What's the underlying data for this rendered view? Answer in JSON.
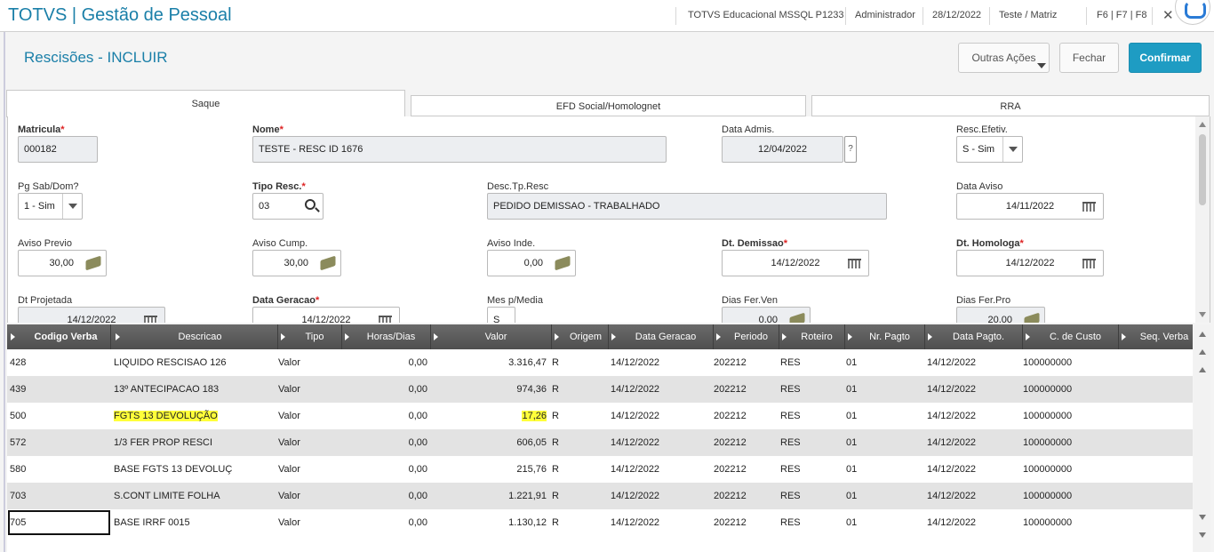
{
  "topbar": {
    "app_title": "TOTVS | Gestão de Pessoal",
    "environment": "TOTVS Educacional MSSQL P1233",
    "user": "Administrador",
    "date": "28/12/2022",
    "branch": "Teste / Matriz",
    "shortcuts": "F6 | F7 | F8",
    "close": "✕"
  },
  "header": {
    "title": "Rescisões - INCLUIR",
    "other_actions": "Outras Ações",
    "close_label": "Fechar",
    "confirm_label": "Confirmar"
  },
  "tabs": [
    {
      "label": "Saque",
      "active": true
    },
    {
      "label": "EFD Social/Homolognet",
      "active": false
    },
    {
      "label": "RRA",
      "active": false
    }
  ],
  "form": {
    "matricula": {
      "label": "Matricula",
      "value": "000182"
    },
    "nome": {
      "label": "Nome",
      "value": "TESTE - RESC ID 1676"
    },
    "data_admis": {
      "label": "Data Admis.",
      "value": "12/04/2022",
      "help": "?"
    },
    "resc_efetiv": {
      "label": "Resc.Efetiv.",
      "value": "S - Sim"
    },
    "pg_sab_dom": {
      "label": "Pg Sab/Dom?",
      "value": "1 - Sim"
    },
    "tipo_resc": {
      "label": "Tipo Resc.",
      "value": "03"
    },
    "desc_tp_resc": {
      "label": "Desc.Tp.Resc",
      "value": "PEDIDO DEMISSAO - TRABALHADO"
    },
    "data_aviso": {
      "label": "Data Aviso",
      "value": "14/11/2022"
    },
    "aviso_previo": {
      "label": "Aviso Previo",
      "value": "30,00"
    },
    "aviso_cump": {
      "label": "Aviso Cump.",
      "value": "30,00"
    },
    "aviso_inde": {
      "label": "Aviso Inde.",
      "value": "0,00"
    },
    "dt_demissao": {
      "label": "Dt. Demissao",
      "value": "14/12/2022"
    },
    "dt_homologa": {
      "label": "Dt. Homologa",
      "value": "14/12/2022"
    },
    "dt_projetada": {
      "label": "Dt Projetada",
      "value": "14/12/2022"
    },
    "data_geracao": {
      "label": "Data Geracao",
      "value": "14/12/2022"
    },
    "mes_p_media": {
      "label": "Mes p/Media",
      "value": "S"
    },
    "dias_fer_ven": {
      "label": "Dias Fer.Ven",
      "value": "0,00"
    },
    "dias_fer_pro": {
      "label": "Dias Fer.Pro",
      "value": "20,00"
    }
  },
  "grid": {
    "columns": [
      "Codigo Verba",
      "Descricao",
      "Tipo",
      "Horas/Dias",
      "Valor",
      "Origem",
      "Data Geracao",
      "Periodo",
      "Roteiro",
      "Nr. Pagto",
      "Data Pagto.",
      "C. de Custo",
      "Seq. Verba"
    ],
    "rows": [
      {
        "codigo": "428",
        "descricao": "LIQUIDO RESCISAO 126",
        "tipo": "Valor",
        "horas": "0,00",
        "valor": "3.316,47",
        "origem": "R",
        "data_geracao": "14/12/2022",
        "periodo": "202212",
        "roteiro": "RES",
        "nr_pagto": "01",
        "data_pagto": "14/12/2022",
        "c_custo": "100000000",
        "highlight": false
      },
      {
        "codigo": "439",
        "descricao": "13º ANTECIPACAO 183",
        "tipo": "Valor",
        "horas": "0,00",
        "valor": "974,36",
        "origem": "R",
        "data_geracao": "14/12/2022",
        "periodo": "202212",
        "roteiro": "RES",
        "nr_pagto": "01",
        "data_pagto": "14/12/2022",
        "c_custo": "100000000",
        "highlight": false
      },
      {
        "codigo": "500",
        "descricao": "FGTS 13 DEVOLUÇÃO",
        "tipo": "Valor",
        "horas": "0,00",
        "valor": "17,26",
        "origem": "R",
        "data_geracao": "14/12/2022",
        "periodo": "202212",
        "roteiro": "RES",
        "nr_pagto": "01",
        "data_pagto": "14/12/2022",
        "c_custo": "100000000",
        "highlight": true
      },
      {
        "codigo": "572",
        "descricao": "1/3 FER PROP RESCI",
        "tipo": "Valor",
        "horas": "0,00",
        "valor": "606,05",
        "origem": "R",
        "data_geracao": "14/12/2022",
        "periodo": "202212",
        "roteiro": "RES",
        "nr_pagto": "01",
        "data_pagto": "14/12/2022",
        "c_custo": "100000000",
        "highlight": false
      },
      {
        "codigo": "580",
        "descricao": "BASE FGTS 13 DEVOLUÇ",
        "tipo": "Valor",
        "horas": "0,00",
        "valor": "215,76",
        "origem": "R",
        "data_geracao": "14/12/2022",
        "periodo": "202212",
        "roteiro": "RES",
        "nr_pagto": "01",
        "data_pagto": "14/12/2022",
        "c_custo": "100000000",
        "highlight": false
      },
      {
        "codigo": "703",
        "descricao": "S.CONT LIMITE FOLHA",
        "tipo": "Valor",
        "horas": "0,00",
        "valor": "1.221,91",
        "origem": "R",
        "data_geracao": "14/12/2022",
        "periodo": "202212",
        "roteiro": "RES",
        "nr_pagto": "01",
        "data_pagto": "14/12/2022",
        "c_custo": "100000000",
        "highlight": false
      },
      {
        "codigo": "705",
        "descricao": "BASE IRRF 0015",
        "tipo": "Valor",
        "horas": "0,00",
        "valor": "1.130,12",
        "origem": "R",
        "data_geracao": "14/12/2022",
        "periodo": "202212",
        "roteiro": "RES",
        "nr_pagto": "01",
        "data_pagto": "14/12/2022",
        "c_custo": "100000000",
        "highlight": false
      }
    ]
  },
  "colors": {
    "brand": "#1a7fa8",
    "confirm": "#1e9cc3",
    "highlight": "#ffff3a",
    "required": "#dd2222"
  }
}
